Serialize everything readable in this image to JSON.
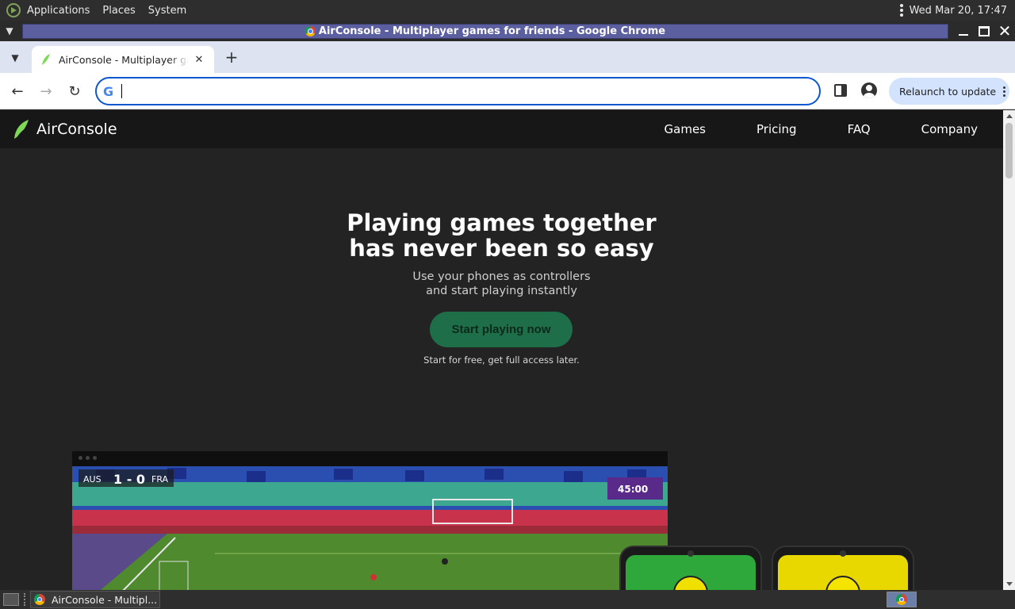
{
  "top_panel": {
    "menus": [
      "Applications",
      "Places",
      "System"
    ],
    "clock": "Wed Mar 20, 17:47"
  },
  "window": {
    "title": "AirConsole - Multiplayer games for friends - Google Chrome"
  },
  "browser": {
    "tab_title": "AirConsole - Multiplayer games for friends",
    "address_value": "",
    "relaunch_label": "Relaunch to update"
  },
  "site": {
    "logo_text": "AirConsole",
    "nav": [
      "Games",
      "Pricing",
      "FAQ",
      "Company"
    ],
    "hero_line1": "Playing games together",
    "hero_line2": "has never been so easy",
    "sub_line1": "Use your phones as controllers",
    "sub_line2": "and start playing instantly",
    "cta_label": "Start playing now",
    "cta_note": "Start for free, get full access later.",
    "game_score": "1 - 0",
    "game_time": "45:00",
    "team_left": "AUS",
    "team_right": "FRA"
  },
  "taskbar": {
    "task_label": "AirConsole - Multipl..."
  },
  "colors": {
    "accent_brand": "#7ed957",
    "cta_bg": "#1e6e4a",
    "omnibox_focus": "#0b57d0",
    "page_bg": "#232323"
  }
}
